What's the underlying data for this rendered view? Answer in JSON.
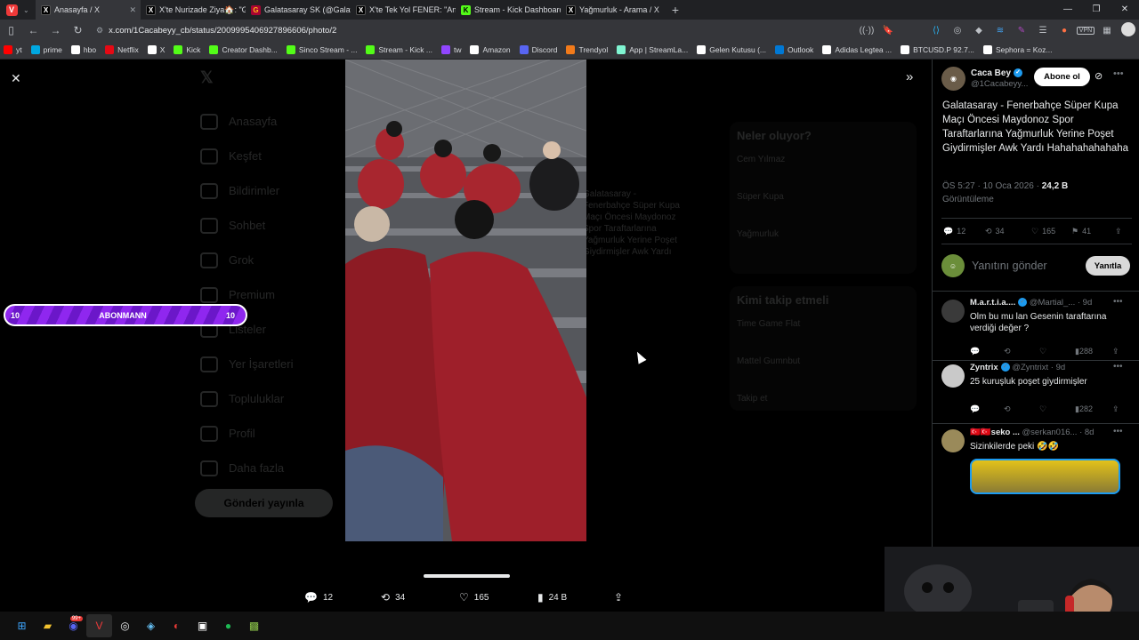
{
  "browser": {
    "tabs": [
      {
        "label": "Anasayfa / X",
        "icon": "x-icon",
        "active": true
      },
      {
        "label": "X'te Nurizade Ziya🏠: \"Gal",
        "icon": "x-icon",
        "active": false
      },
      {
        "label": "Galatasaray SK (@Galatasa",
        "icon": "galatasaray-icon",
        "active": false
      },
      {
        "label": "X'te Tek Yol FENER: \"Anlık s",
        "icon": "x-icon",
        "active": false
      },
      {
        "label": "Stream - Kick Dashboard",
        "icon": "kick-icon",
        "active": false
      },
      {
        "label": "Yağmurluk - Arama / X",
        "icon": "x-icon",
        "active": false
      }
    ],
    "url": "x.com/1Cacabeyy_cb/status/2009995406927896606/photo/2",
    "bookmarks": [
      {
        "label": "yt",
        "icon": "youtube-icon",
        "color": "#ff0000"
      },
      {
        "label": "prime",
        "icon": "prime-icon",
        "color": "#00a8e1"
      },
      {
        "label": "hbo",
        "icon": "hbo-icon",
        "color": "#ffffff"
      },
      {
        "label": "Netflix",
        "icon": "netflix-icon",
        "color": "#e50914"
      },
      {
        "label": "X",
        "icon": "x-icon",
        "color": "#ffffff"
      },
      {
        "label": "Kick",
        "icon": "kick-icon",
        "color": "#53fc18"
      },
      {
        "label": "Creator Dashb...",
        "icon": "kick-icon",
        "color": "#53fc18"
      },
      {
        "label": "Sinco Stream - ...",
        "icon": "kick-icon",
        "color": "#53fc18"
      },
      {
        "label": "Stream - Kick ...",
        "icon": "kick-icon",
        "color": "#53fc18"
      },
      {
        "label": "tw",
        "icon": "twitch-icon",
        "color": "#9146ff"
      },
      {
        "label": "Amazon",
        "icon": "amazon-icon",
        "color": "#ffffff"
      },
      {
        "label": "Discord",
        "icon": "discord-icon",
        "color": "#5865f2"
      },
      {
        "label": "Trendyol",
        "icon": "trendyol-icon",
        "color": "#f27a1a"
      },
      {
        "label": "App | StreamLa...",
        "icon": "streamlabs-icon",
        "color": "#80f5d2"
      },
      {
        "label": "Gelen Kutusu (...",
        "icon": "mail-icon",
        "color": "#ffffff"
      },
      {
        "label": "Outlook",
        "icon": "outlook-icon",
        "color": "#0078d4"
      },
      {
        "label": "Adidas Legtea ...",
        "icon": "adidas-icon",
        "color": "#ffffff"
      },
      {
        "label": "BTCUSD.P 92.7...",
        "icon": "tradingview-icon",
        "color": "#ffffff"
      },
      {
        "label": "Sephora = Koz...",
        "icon": "sephora-icon",
        "color": "#ffffff"
      }
    ]
  },
  "media": {
    "actions": {
      "replies": "12",
      "retweets": "34",
      "likes": "165",
      "views": "24 B"
    }
  },
  "stream_overlay": {
    "left_count": "10",
    "label": "ABONMANN",
    "right_count": "10"
  },
  "background": {
    "nav": [
      "Anasayfa",
      "Keşfet",
      "Bildirimler",
      "Sohbet",
      "Grok",
      "Premium",
      "Listeler",
      "Yer İşaretleri",
      "Topluluklar",
      "Profil",
      "Daha fazla"
    ],
    "post_button": "Gönderi yayınla",
    "trend_title": "Neler oluyor?",
    "trends": [
      "Cem Yılmaz",
      "Süper Kupa",
      "Yağmurluk"
    ],
    "follow_title": "Kimi takip etmeli",
    "suggestions": [
      "Time Game Flat",
      "Mattel Gumnbut"
    ],
    "follow_label": "Takip et",
    "middle_text": "Galatasaray - Fenerbahçe Süper Kupa Maçı Öncesi Maydonoz Spor Taraftarlarına Yağmurluk Yerine Poşet Giydirmişler Awk Yardı"
  },
  "tweet": {
    "author_name": "Caca Bey",
    "author_handle": "@1Cacabeyy...",
    "follow_label": "Abone ol",
    "text": "Galatasaray - Fenerbahçe Süper Kupa Maçı Öncesi Maydonoz Spor Taraftarlarına Yağmurluk Yerine Poşet Giydirmişler Awk Yardı Hahahahahahaha",
    "time": "ÖS 5:27 · 10 Oca 2026 · ",
    "views": "24,2 B",
    "views_label": "Görüntüleme",
    "stats": {
      "replies": "12",
      "retweets": "34",
      "likes": "165",
      "bookmarks": "41"
    },
    "reply_placeholder": "Yanıtını gönder",
    "reply_button": "Yanıtla"
  },
  "replies": [
    {
      "name": "M.a.r.t.i.a....",
      "handle": "@Martial_...",
      "age": "· 9d",
      "text": "Olm bu mu lan Gesenin taraftarına verdiği değer ?",
      "views": "288",
      "avatar_color": "#3a3a3a"
    },
    {
      "name": "Zyntrix",
      "handle": "@Zyntrixt",
      "age": "· 9d",
      "text": "25 kuruşluk poşet giydirmişler",
      "views": "282",
      "avatar_color": "#c9c9c9"
    },
    {
      "name": "🇹🇷🇹🇷seko ...",
      "handle": "@serkan016...",
      "age": "· 8d",
      "text": "Sizinkilerde peki 🤣🤣",
      "views": "",
      "avatar_color": "#9a8a5a"
    }
  ]
}
